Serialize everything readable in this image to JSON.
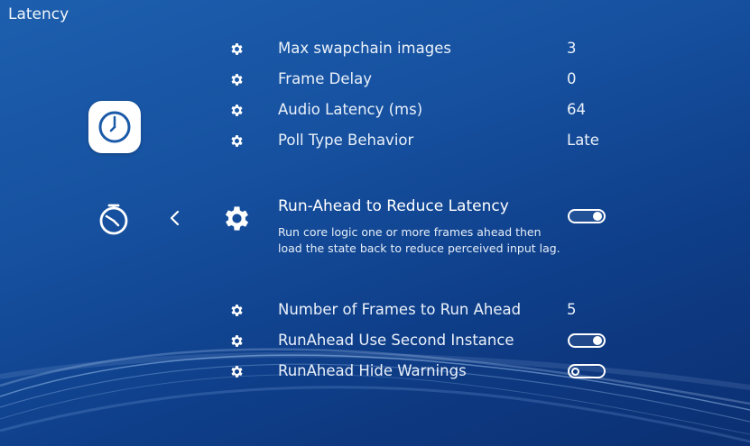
{
  "header": {
    "title": "Latency"
  },
  "icons": {
    "category": "clock-icon",
    "sidebar": "stopwatch-icon",
    "back": "chevron-left-icon",
    "setting": "gear-icon"
  },
  "settings_top": [
    {
      "label": "Max swapchain images",
      "value": "3"
    },
    {
      "label": "Frame Delay",
      "value": "0"
    },
    {
      "label": "Audio Latency (ms)",
      "value": "64"
    },
    {
      "label": "Poll Type Behavior",
      "value": "Late"
    }
  ],
  "selected": {
    "label": "Run-Ahead to Reduce Latency",
    "description": "Run core logic one or more frames ahead then load the state back to reduce perceived input lag.",
    "toggle": "on"
  },
  "settings_bottom": [
    {
      "label": "Number of Frames to Run Ahead",
      "value": "5"
    },
    {
      "label": "RunAhead Use Second Instance",
      "toggle": "on"
    },
    {
      "label": "RunAhead Hide Warnings",
      "toggle": "off"
    }
  ],
  "colors": {
    "background_top": "#1d5fae",
    "background_bottom": "#0b2f72",
    "text": "#ffffff"
  }
}
